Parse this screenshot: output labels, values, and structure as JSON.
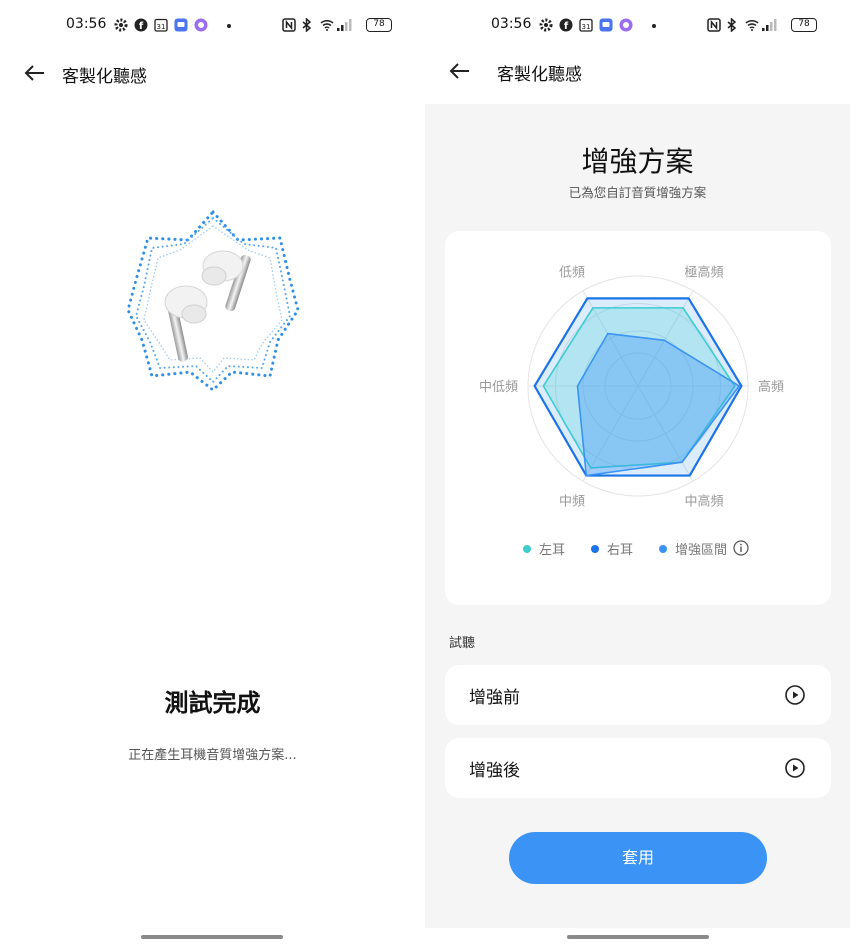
{
  "status_bar": {
    "time": "03:56",
    "battery": "78"
  },
  "left": {
    "nav_title": "客製化聽感",
    "heading": "測試完成",
    "subtitle": "正在產生耳機音質增強方案..."
  },
  "right": {
    "nav_title": "客製化聽感",
    "heading": "增強方案",
    "subtitle": "已為您自訂音質增強方案",
    "radar": {
      "axes": [
        "低頻",
        "極高頻",
        "高頻",
        "中高頻",
        "中頻",
        "中低頻"
      ],
      "left_ear": [
        0.82,
        0.82,
        0.88,
        0.8,
        0.86,
        0.86
      ],
      "right_ear": [
        0.92,
        0.92,
        0.94,
        0.94,
        0.94,
        0.94
      ],
      "enhance": [
        0.55,
        0.48,
        0.92,
        0.8,
        0.94,
        0.55
      ]
    },
    "legend": {
      "left_ear": "左耳",
      "right_ear": "右耳",
      "enhance": "增強區間"
    },
    "colors": {
      "left_ear": "#3dcccf",
      "right_ear": "#1a73e8",
      "enhance": "#3a93f5"
    },
    "section_label": "試聽",
    "before_label": "增強前",
    "after_label": "增強後",
    "apply_label": "套用"
  }
}
